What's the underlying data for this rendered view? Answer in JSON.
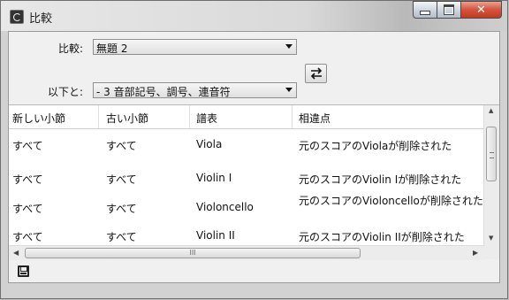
{
  "window": {
    "title": "比較",
    "app_icon": "app-logo-icon",
    "controls": {
      "minimize": "minimize-icon",
      "maximize": "maximize-icon",
      "close": "✕"
    }
  },
  "compare": {
    "compare_label": "比較:",
    "compare_value": "無題 2",
    "with_label": "以下と:",
    "with_value": "- 3 音部記号、調号、連音符",
    "swap_icon": "swap-arrows-icon"
  },
  "table": {
    "columns": [
      "新しい小節",
      "古い小節",
      "譜表",
      "相違点"
    ],
    "rows": [
      [
        "すべて",
        "すべて",
        "Viola",
        "元のスコアのViolaが削除された"
      ],
      [
        "すべて",
        "すべて",
        "Violin I",
        "元のスコアのViolin Iが削除された"
      ],
      [
        "すべて",
        "すべて",
        "Violoncello",
        "元のスコアのVioloncelloが削除された"
      ],
      [
        "すべて",
        "すべて",
        "Violin II",
        "元のスコアのViolin IIが削除された"
      ]
    ],
    "hscroll_grip": "III"
  },
  "footer": {
    "save_icon": "floppy-save-icon"
  },
  "colors": {
    "close_button": "#c9452e",
    "panel": "#f0f0f0"
  }
}
